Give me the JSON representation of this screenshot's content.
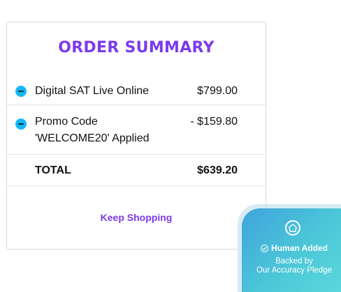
{
  "summary": {
    "title": "ORDER SUMMARY",
    "items": [
      {
        "label": "Digital SAT Live Online",
        "price": "$799.00"
      },
      {
        "label": "Promo Code 'WELCOME20' Applied",
        "price": "- $159.80"
      }
    ],
    "total_label": "TOTAL",
    "total_value": "$639.20",
    "keep_shopping": "Keep Shopping"
  },
  "badge": {
    "headline": "Human Added",
    "line1": "Backed by",
    "line2": "Our Accuracy Pledge"
  },
  "colors": {
    "accent": "#7c3aed",
    "minus_icon": "#16b8f3",
    "badge_gradient_start": "#3fa4dc",
    "badge_gradient_end": "#5cd9dc"
  }
}
